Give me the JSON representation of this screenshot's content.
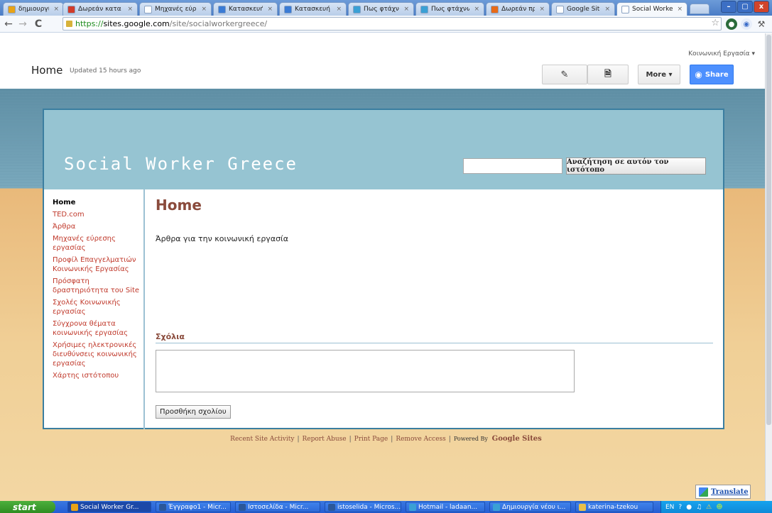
{
  "browser": {
    "tabs": [
      {
        "label": "δημιουργία ισ",
        "favicon_color": "#e8a317"
      },
      {
        "label": "Δωρεάν κατα",
        "favicon_color": "#d23c2a"
      },
      {
        "label": "Μηχανές εύρ",
        "favicon_color": "#ffffff"
      },
      {
        "label": "Κατασκευή Ισ",
        "favicon_color": "#3a7bd5"
      },
      {
        "label": "Κατασκευή ισ",
        "favicon_color": "#3a7bd5"
      },
      {
        "label": "Πως φτάχνω",
        "favicon_color": "#3aa0d5"
      },
      {
        "label": "Πως φτάχνω",
        "favicon_color": "#3aa0d5"
      },
      {
        "label": "Δωρεάν προγ",
        "favicon_color": "#e86a17"
      },
      {
        "label": "Google Sites",
        "favicon_color": "#ffffff"
      },
      {
        "label": "Social Worker",
        "favicon_color": "#ffffff"
      }
    ],
    "tab_close_glyph": "×",
    "url": {
      "scheme": "https://",
      "host": "sites.google.com",
      "path": "/site/socialworkergreece/"
    },
    "window_controls": [
      "–",
      "▢",
      "x"
    ]
  },
  "sites_header": {
    "user_menu": "Κοινωνική Εργασία",
    "page_title": "Home",
    "updated": "Updated 15 hours ago",
    "more_label": "More",
    "share_label": "Share"
  },
  "site": {
    "title": "Social Worker Greece",
    "search_button": "Αναζήτηση σε αυτόν τον ιστότοπο",
    "nav": [
      {
        "label": "Home",
        "current": true
      },
      {
        "label": "TED.com"
      },
      {
        "label": "Άρθρα"
      },
      {
        "label": "Μηχανές εύρεσης εργασίας"
      },
      {
        "label": "Προφίλ Επαγγελματιών Κοινωνικής Εργασίας"
      },
      {
        "label": "Πρόσφατη δραστηριότητα του Site"
      },
      {
        "label": "Σχολές Κοινωνικής εργασίας"
      },
      {
        "label": "Σύγχρονα θέματα κοινωνικής εργασίας"
      },
      {
        "label": "Χρήσιμες ηλεκτρονικές διευθύνσεις κοινωνικής εργασίας"
      },
      {
        "label": "Χάρτης ιστότοπου"
      }
    ],
    "main_title": "Home",
    "main_text": "Άρθρα για την κοινωνική εργασία",
    "comments_title": "Σχόλια",
    "comment_button": "Προσθήκη σχολίου",
    "footer": {
      "recent": "Recent Site Activity",
      "report": "Report Abuse",
      "print": "Print Page",
      "remove": "Remove Access",
      "powered": "Powered By",
      "google_sites": "Google Sites"
    },
    "translate": "Translate"
  },
  "taskbar": {
    "start": "start",
    "tasks": [
      {
        "label": "Social Worker Gr...",
        "icon_color": "#e8a317",
        "active": true
      },
      {
        "label": "Έγγραφο1 - Micr...",
        "icon_color": "#2b579a"
      },
      {
        "label": "Ιστοσελίδα - Micr...",
        "icon_color": "#2b579a"
      },
      {
        "label": "istoselida - Micros...",
        "icon_color": "#2b579a"
      },
      {
        "label": "Hotmail - ladaan...",
        "icon_color": "#3aa0d5"
      },
      {
        "label": "Δημιουργία νέου ι...",
        "icon_color": "#3aa0d5"
      },
      {
        "label": "katerina-tzekou",
        "icon_color": "#e8c04a"
      }
    ],
    "lang": "EN"
  },
  "colors": {
    "accent_link": "#c0392b",
    "heading": "#8a4b3c",
    "header_band": "#96c4d2",
    "share_blue": "#4d90fe"
  }
}
